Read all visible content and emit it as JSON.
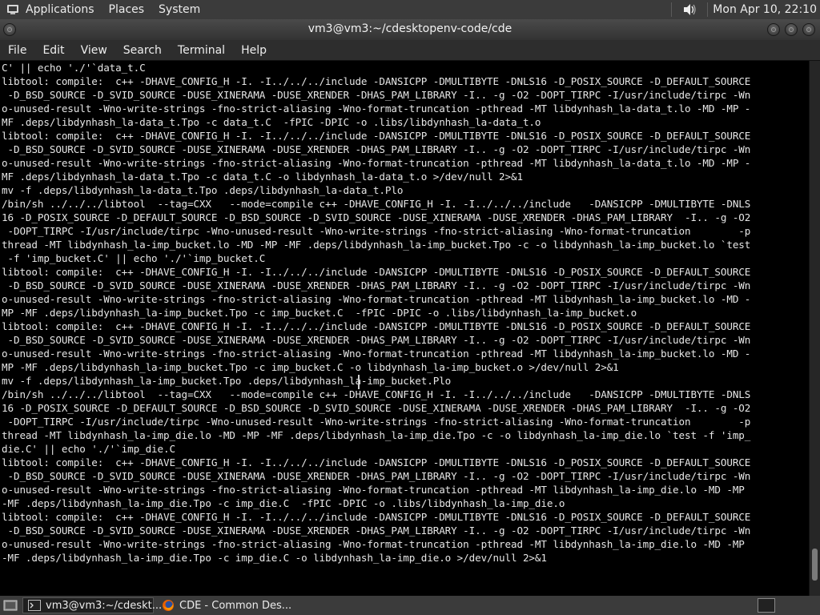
{
  "top_panel": {
    "menus": [
      "Applications",
      "Places",
      "System"
    ],
    "clock": "Mon Apr 10, 22:10",
    "icons": [
      "app-menu-icon",
      "volume-icon"
    ]
  },
  "window": {
    "title": "vm3@vm3:~/cdesktopenv-code/cde",
    "menu": [
      "File",
      "Edit",
      "View",
      "Search",
      "Terminal",
      "Help"
    ]
  },
  "terminal": {
    "lines": [
      "C' || echo './'`data_t.C",
      "libtool: compile:  c++ -DHAVE_CONFIG_H -I. -I../../../include -DANSICPP -DMULTIBYTE -DNLS16 -D_POSIX_SOURCE -D_DEFAULT_SOURCE",
      " -D_BSD_SOURCE -D_SVID_SOURCE -DUSE_XINERAMA -DUSE_XRENDER -DHAS_PAM_LIBRARY -I.. -g -O2 -DOPT_TIRPC -I/usr/include/tirpc -Wn",
      "o-unused-result -Wno-write-strings -fno-strict-aliasing -Wno-format-truncation -pthread -MT libdynhash_la-data_t.lo -MD -MP -",
      "MF .deps/libdynhash_la-data_t.Tpo -c data_t.C  -fPIC -DPIC -o .libs/libdynhash_la-data_t.o",
      "libtool: compile:  c++ -DHAVE_CONFIG_H -I. -I../../../include -DANSICPP -DMULTIBYTE -DNLS16 -D_POSIX_SOURCE -D_DEFAULT_SOURCE",
      " -D_BSD_SOURCE -D_SVID_SOURCE -DUSE_XINERAMA -DUSE_XRENDER -DHAS_PAM_LIBRARY -I.. -g -O2 -DOPT_TIRPC -I/usr/include/tirpc -Wn",
      "o-unused-result -Wno-write-strings -fno-strict-aliasing -Wno-format-truncation -pthread -MT libdynhash_la-data_t.lo -MD -MP -",
      "MF .deps/libdynhash_la-data_t.Tpo -c data_t.C -o libdynhash_la-data_t.o >/dev/null 2>&1",
      "mv -f .deps/libdynhash_la-data_t.Tpo .deps/libdynhash_la-data_t.Plo",
      "/bin/sh ../../../libtool  --tag=CXX   --mode=compile c++ -DHAVE_CONFIG_H -I. -I../../../include   -DANSICPP -DMULTIBYTE -DNLS",
      "16 -D_POSIX_SOURCE -D_DEFAULT_SOURCE -D_BSD_SOURCE -D_SVID_SOURCE -DUSE_XINERAMA -DUSE_XRENDER -DHAS_PAM_LIBRARY  -I.. -g -O2",
      " -DOPT_TIRPC -I/usr/include/tirpc -Wno-unused-result -Wno-write-strings -fno-strict-aliasing -Wno-format-truncation        -p",
      "thread -MT libdynhash_la-imp_bucket.lo -MD -MP -MF .deps/libdynhash_la-imp_bucket.Tpo -c -o libdynhash_la-imp_bucket.lo `test",
      " -f 'imp_bucket.C' || echo './'`imp_bucket.C",
      "libtool: compile:  c++ -DHAVE_CONFIG_H -I. -I../../../include -DANSICPP -DMULTIBYTE -DNLS16 -D_POSIX_SOURCE -D_DEFAULT_SOURCE",
      " -D_BSD_SOURCE -D_SVID_SOURCE -DUSE_XINERAMA -DUSE_XRENDER -DHAS_PAM_LIBRARY -I.. -g -O2 -DOPT_TIRPC -I/usr/include/tirpc -Wn",
      "o-unused-result -Wno-write-strings -fno-strict-aliasing -Wno-format-truncation -pthread -MT libdynhash_la-imp_bucket.lo -MD -",
      "MP -MF .deps/libdynhash_la-imp_bucket.Tpo -c imp_bucket.C  -fPIC -DPIC -o .libs/libdynhash_la-imp_bucket.o",
      "libtool: compile:  c++ -DHAVE_CONFIG_H -I. -I../../../include -DANSICPP -DMULTIBYTE -DNLS16 -D_POSIX_SOURCE -D_DEFAULT_SOURCE",
      " -D_BSD_SOURCE -D_SVID_SOURCE -DUSE_XINERAMA -DUSE_XRENDER -DHAS_PAM_LIBRARY -I.. -g -O2 -DOPT_TIRPC -I/usr/include/tirpc -Wn",
      "o-unused-result -Wno-write-strings -fno-strict-aliasing -Wno-format-truncation -pthread -MT libdynhash_la-imp_bucket.lo -MD -",
      "MP -MF .deps/libdynhash_la-imp_bucket.Tpo -c imp_bucket.C -o libdynhash_la-imp_bucket.o >/dev/null 2>&1",
      "mv -f .deps/libdynhash_la-imp_bucket.Tpo .deps/libdynhash_la-imp_bucket.Plo",
      "/bin/sh ../../../libtool  --tag=CXX   --mode=compile c++ -DHAVE_CONFIG_H -I. -I../../../include   -DANSICPP -DMULTIBYTE -DNLS",
      "16 -D_POSIX_SOURCE -D_DEFAULT_SOURCE -D_BSD_SOURCE -D_SVID_SOURCE -DUSE_XINERAMA -DUSE_XRENDER -DHAS_PAM_LIBRARY  -I.. -g -O2",
      " -DOPT_TIRPC -I/usr/include/tirpc -Wno-unused-result -Wno-write-strings -fno-strict-aliasing -Wno-format-truncation        -p",
      "thread -MT libdynhash_la-imp_die.lo -MD -MP -MF .deps/libdynhash_la-imp_die.Tpo -c -o libdynhash_la-imp_die.lo `test -f 'imp_",
      "die.C' || echo './'`imp_die.C",
      "libtool: compile:  c++ -DHAVE_CONFIG_H -I. -I../../../include -DANSICPP -DMULTIBYTE -DNLS16 -D_POSIX_SOURCE -D_DEFAULT_SOURCE",
      " -D_BSD_SOURCE -D_SVID_SOURCE -DUSE_XINERAMA -DUSE_XRENDER -DHAS_PAM_LIBRARY -I.. -g -O2 -DOPT_TIRPC -I/usr/include/tirpc -Wn",
      "o-unused-result -Wno-write-strings -fno-strict-aliasing -Wno-format-truncation -pthread -MT libdynhash_la-imp_die.lo -MD -MP",
      "-MF .deps/libdynhash_la-imp_die.Tpo -c imp_die.C  -fPIC -DPIC -o .libs/libdynhash_la-imp_die.o",
      "libtool: compile:  c++ -DHAVE_CONFIG_H -I. -I../../../include -DANSICPP -DMULTIBYTE -DNLS16 -D_POSIX_SOURCE -D_DEFAULT_SOURCE",
      " -D_BSD_SOURCE -D_SVID_SOURCE -DUSE_XINERAMA -DUSE_XRENDER -DHAS_PAM_LIBRARY -I.. -g -O2 -DOPT_TIRPC -I/usr/include/tirpc -Wn",
      "o-unused-result -Wno-write-strings -fno-strict-aliasing -Wno-format-truncation -pthread -MT libdynhash_la-imp_die.lo -MD -MP",
      "-MF .deps/libdynhash_la-imp_die.Tpo -c imp_die.C -o libdynhash_la-imp_die.o >/dev/null 2>&1"
    ],
    "scroll_position": 0.97,
    "visible_fraction": 0.06
  },
  "taskbar": {
    "tasks": [
      {
        "label": "vm3@vm3:~/cdeskt...",
        "icon": "terminal-icon",
        "active": true
      },
      {
        "label": "CDE - Common Des...",
        "icon": "firefox-icon",
        "active": false
      }
    ],
    "icons": [
      "show-desktop-icon",
      "workspace-switcher-icon"
    ]
  }
}
